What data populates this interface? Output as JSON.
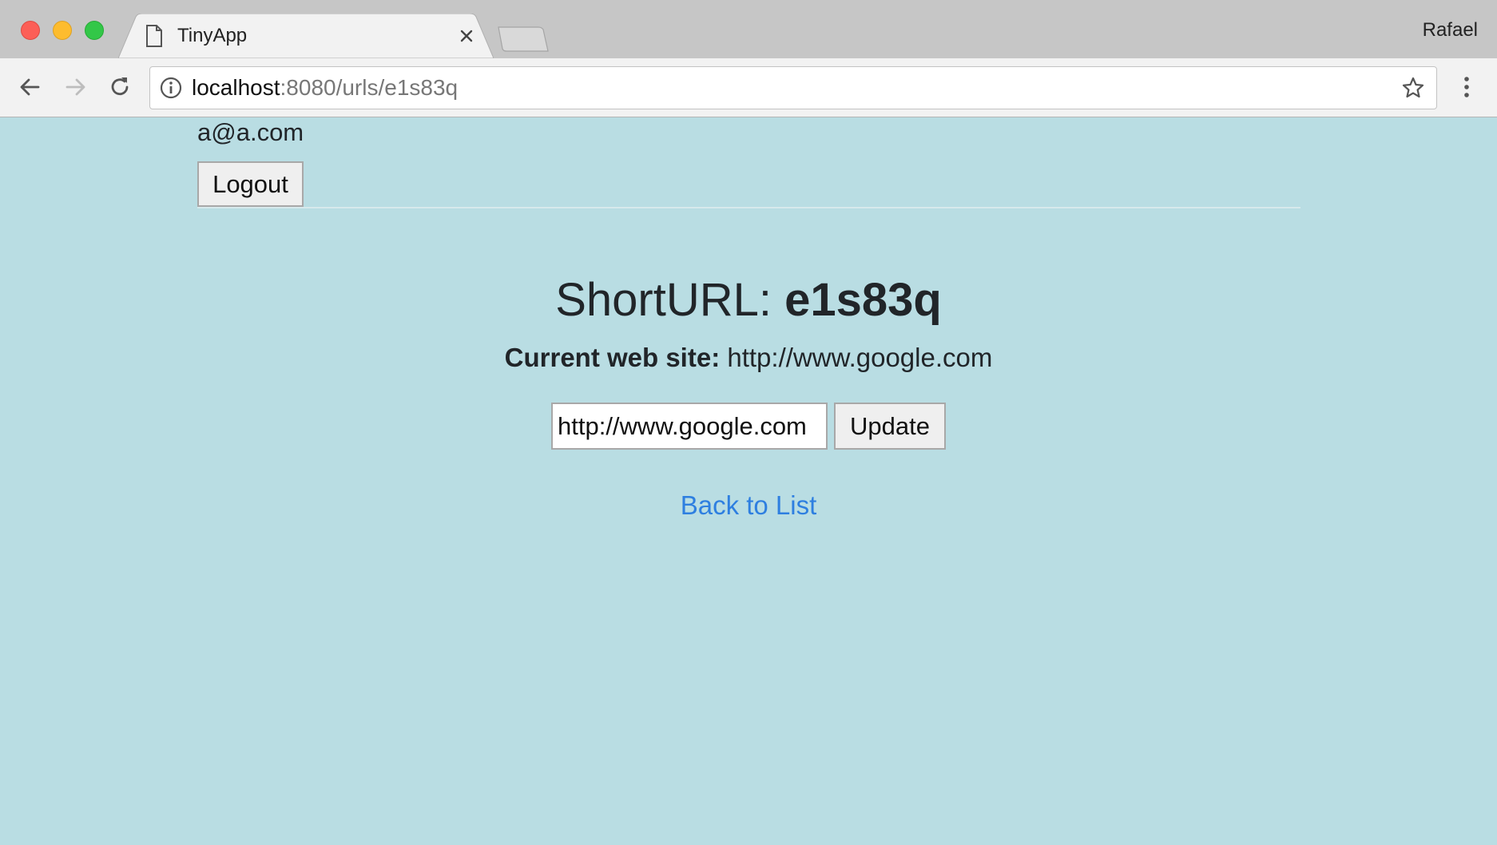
{
  "browser": {
    "tab_title": "TinyApp",
    "profile_name": "Rafael",
    "url_host": "localhost",
    "url_path": ":8080/urls/e1s83q"
  },
  "page": {
    "user_email": "a@a.com",
    "logout_label": "Logout",
    "heading_prefix": "ShortURL: ",
    "short_url": "e1s83q",
    "current_site_label": "Current web site:",
    "current_site_value": " http://www.google.com",
    "input_value": "http://www.google.com",
    "update_label": "Update",
    "back_link_label": "Back to List"
  },
  "colors": {
    "page_background": "#b9dde3",
    "link": "#2e7fe0",
    "text": "#212529"
  },
  "icons": {
    "favicon": "document-icon",
    "close": "close-icon",
    "back": "back-arrow-icon",
    "forward": "forward-arrow-icon",
    "reload": "reload-icon",
    "info": "info-icon",
    "bookmark": "star-icon",
    "menu": "kebab-menu-icon"
  }
}
